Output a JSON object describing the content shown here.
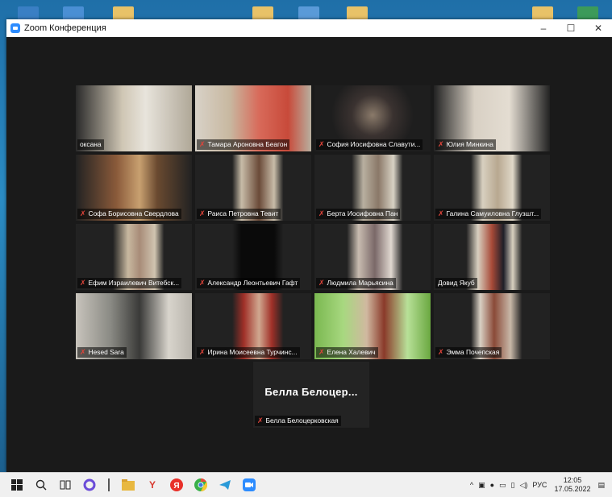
{
  "window": {
    "title": "Zoom Конференция",
    "buttons": {
      "minimize": "–",
      "maximize": "☐",
      "close": "✕"
    }
  },
  "participants": [
    {
      "name": "оксана",
      "muted": false
    },
    {
      "name": "Тамара Ароновна Беагон",
      "muted": true
    },
    {
      "name": "София Иосифовна Славути...",
      "muted": true
    },
    {
      "name": "Юлия Минкина",
      "muted": true
    },
    {
      "name": "Софа Борисовна Свердлова",
      "muted": true
    },
    {
      "name": "Раиса Петровна Тевит",
      "muted": true
    },
    {
      "name": "Берта Иосифовна Пан",
      "muted": true
    },
    {
      "name": "Галина Самуиловна Глузшт...",
      "muted": true
    },
    {
      "name": "Ефим Израилевич Витебск...",
      "muted": true
    },
    {
      "name": "Александр Леонтьевич Гафт",
      "muted": true
    },
    {
      "name": "Людмила Марьясина",
      "muted": true
    },
    {
      "name": "Довид Якуб",
      "muted": false,
      "active": true
    },
    {
      "name": "Hesed Sara",
      "muted": true
    },
    {
      "name": "Ирина Моисеевна Турчинс...",
      "muted": true
    },
    {
      "name": "Елена Халевич",
      "muted": true
    },
    {
      "name": "Эмма Почепская",
      "muted": true
    }
  ],
  "no_video_tile": {
    "display": "Белла Белоцер...",
    "name": "Белла Белоцерковская",
    "muted": true
  },
  "taskbar": {
    "language": "РУС",
    "time": "12:05",
    "date": "17.05.2022"
  },
  "colors": {
    "active_speaker": "#c8e05a",
    "mute": "#e0443a",
    "zoom_blue": "#2d8cff"
  }
}
